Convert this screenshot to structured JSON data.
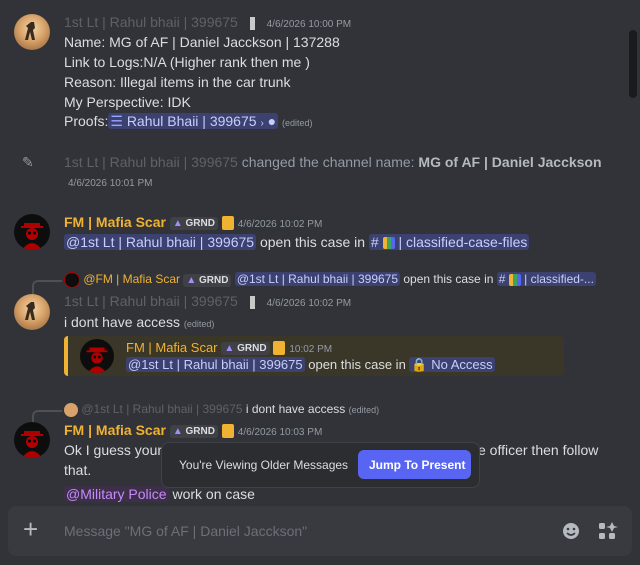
{
  "messages": {
    "m1": {
      "username": "1st Lt  | Rahul bhaii | 399675",
      "timestamp": "4/6/2026 10:00 PM",
      "lines": [
        "Name: MG of AF | Daniel Jacckson | 137288",
        "Link to Logs:N/A (Higher rank then me )",
        "Reason: Illegal items in the car trunk",
        "My Perspective: IDK"
      ],
      "proofs_label": "Proofs:",
      "proofs_link": "Rahul Bhaii | 399675",
      "edited": "(edited)"
    },
    "system": {
      "username": "1st Lt  | Rahul bhaii | 399675",
      "action": " changed the channel name: ",
      "new_name": "MG of AF | Daniel Jacckson",
      "timestamp": "4/6/2026 10:01 PM"
    },
    "m2": {
      "username": "FM | Mafia Scar",
      "tag": "GRND",
      "timestamp": "4/6/2026 10:02 PM",
      "mention": "@1st Lt  | Rahul bhaii | 399675",
      "text": " open this case in ",
      "channel": "classified-case-files"
    },
    "m3": {
      "reply_user": "@FM | Mafia Scar",
      "reply_tag": "GRND",
      "reply_mention": "@1st Lt  | Rahul bhaii | 399675",
      "reply_text": " open this case in ",
      "reply_channel": "classified-...",
      "username": "1st Lt  | Rahul bhaii | 399675",
      "timestamp": "4/6/2026 10:02 PM",
      "text": "i dont have access",
      "edited": "(edited)",
      "embed_user": "FM | Mafia Scar",
      "embed_tag": "GRND",
      "embed_time": "10:02 PM",
      "embed_mention": "@1st Lt  | Rahul bhaii | 399675",
      "embed_text": " open this case in ",
      "embed_noaccess": "No Access"
    },
    "m4": {
      "reply_user": "@1st Lt  | Rahul bhaii | 399675",
      "reply_text": "i dont have access",
      "reply_edited": "(edited)",
      "username": "FM | Mafia Scar",
      "tag": "GRND",
      "timestamp": "4/6/2026 10:03 PM",
      "text1a": "Ok I guess your a",
      "text1b": "e officer then follow",
      "text2": "that.",
      "mention": "@Military Police",
      "text3": " work on case"
    }
  },
  "older_banner": {
    "text": "You're Viewing Older Messages",
    "button": "Jump To Present"
  },
  "composer": {
    "placeholder": "Message \"MG of AF | Daniel Jacckson\""
  }
}
